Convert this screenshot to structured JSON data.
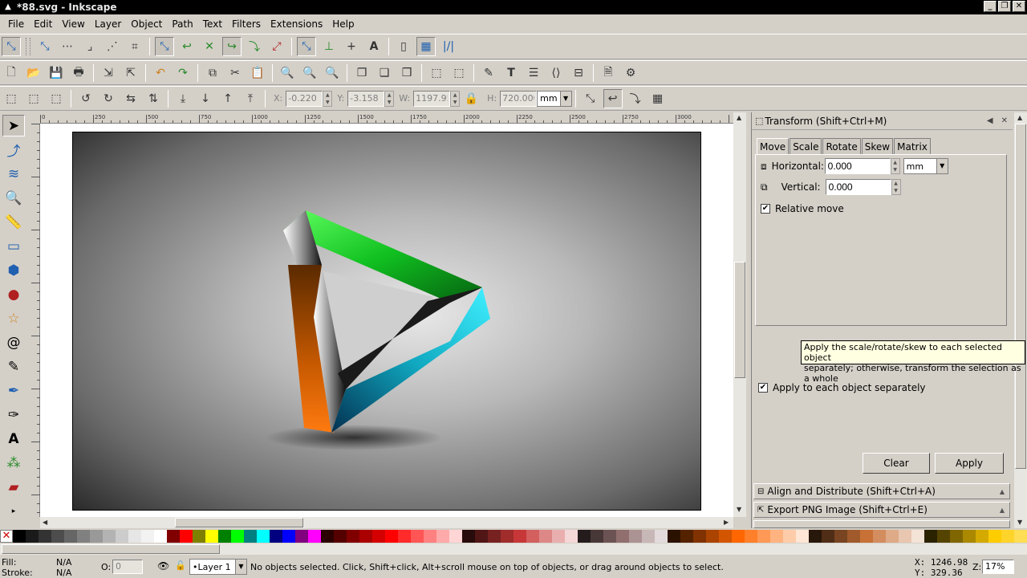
{
  "window": {
    "title": "*88.svg - Inkscape",
    "minimize": "_",
    "maximize": "❐",
    "close": "✕"
  },
  "menu": [
    "File",
    "Edit",
    "View",
    "Layer",
    "Object",
    "Path",
    "Text",
    "Filters",
    "Extensions",
    "Help"
  ],
  "selector_toolbar": {
    "x_label": "X:",
    "x_value": "-0.220",
    "y_label": "Y:",
    "y_value": "-3.158",
    "w_label": "W:",
    "w_value": "1197.95",
    "h_label": "H:",
    "h_value": "720.000",
    "unit": "mm"
  },
  "transform_dialog": {
    "title": "Transform (Shift+Ctrl+M)",
    "tabs": [
      "Move",
      "Scale",
      "Rotate",
      "Skew",
      "Matrix"
    ],
    "active_tab": "Move",
    "horizontal_label": "Horizontal:",
    "horizontal_value": "0.000",
    "vertical_label": "Vertical:",
    "vertical_value": "0.000",
    "unit": "mm",
    "relative_move_label": "Relative move",
    "relative_move_checked": true,
    "apply_each_label": "Apply to each object separately",
    "apply_each_checked": true,
    "clear_label": "Clear",
    "apply_label": "Apply"
  },
  "tooltip": {
    "line1": "Apply the scale/rotate/skew to each selected object",
    "line2": "separately; otherwise, transform the selection as a whole"
  },
  "collapsed_dialogs": [
    "Align and Distribute (Shift+Ctrl+A)",
    "Export PNG Image (Shift+Ctrl+E)"
  ],
  "ruler_labels": [
    "0",
    "250",
    "500",
    "750",
    "1000",
    "1250",
    "1500",
    "1750",
    "2000",
    "2250",
    "2500",
    "2750",
    "3000"
  ],
  "palette": [
    "#000000",
    "#1a1a1a",
    "#333333",
    "#4d4d4d",
    "#666666",
    "#808080",
    "#999999",
    "#b3b3b3",
    "#cccccc",
    "#e6e6e6",
    "#f2f2f2",
    "#ffffff",
    "#800000",
    "#ff0000",
    "#808000",
    "#ffff00",
    "#008000",
    "#00ff00",
    "#008080",
    "#00ffff",
    "#000080",
    "#0000ff",
    "#800080",
    "#ff00ff",
    "#2b0000",
    "#550000",
    "#800000",
    "#aa0000",
    "#d40000",
    "#ff0000",
    "#ff2a2a",
    "#ff5555",
    "#ff8080",
    "#ffaaaa",
    "#ffd5d5",
    "#280b0b",
    "#501616",
    "#782121",
    "#a02c2c",
    "#c83737",
    "#d35f5f",
    "#de8787",
    "#e9afaf",
    "#f4d7d7",
    "#241c1c",
    "#483737",
    "#6c5353",
    "#916f6f",
    "#ac9393",
    "#c8b7b7",
    "#e3dbdb",
    "#2b1100",
    "#552200",
    "#803300",
    "#aa4400",
    "#d45500",
    "#ff6600",
    "#ff7f2a",
    "#ff9955",
    "#ffb380",
    "#ffccaa",
    "#ffe6d5",
    "#28170b",
    "#502d16",
    "#784421",
    "#a05a2c",
    "#c87137",
    "#d38d5f",
    "#deaa87",
    "#e9c6af",
    "#f4e3d7",
    "#2b2200",
    "#554400",
    "#806600",
    "#aa8800",
    "#d4aa00",
    "#ffcc00",
    "#ffd42a",
    "#ffdd55"
  ],
  "statusbar": {
    "fill_label": "Fill:",
    "fill_value": "N/A",
    "stroke_label": "Stroke:",
    "stroke_value": "N/A",
    "opacity_label": "O:",
    "opacity_value": "0",
    "layer": "•Layer 1",
    "message": "No objects selected. Click, Shift+click, Alt+scroll mouse on top of objects, or drag around objects to select.",
    "x_coord": "X: 1246.98",
    "y_coord": "Y:  329.36",
    "zoom_label": "Z:",
    "zoom_value": "17%"
  }
}
